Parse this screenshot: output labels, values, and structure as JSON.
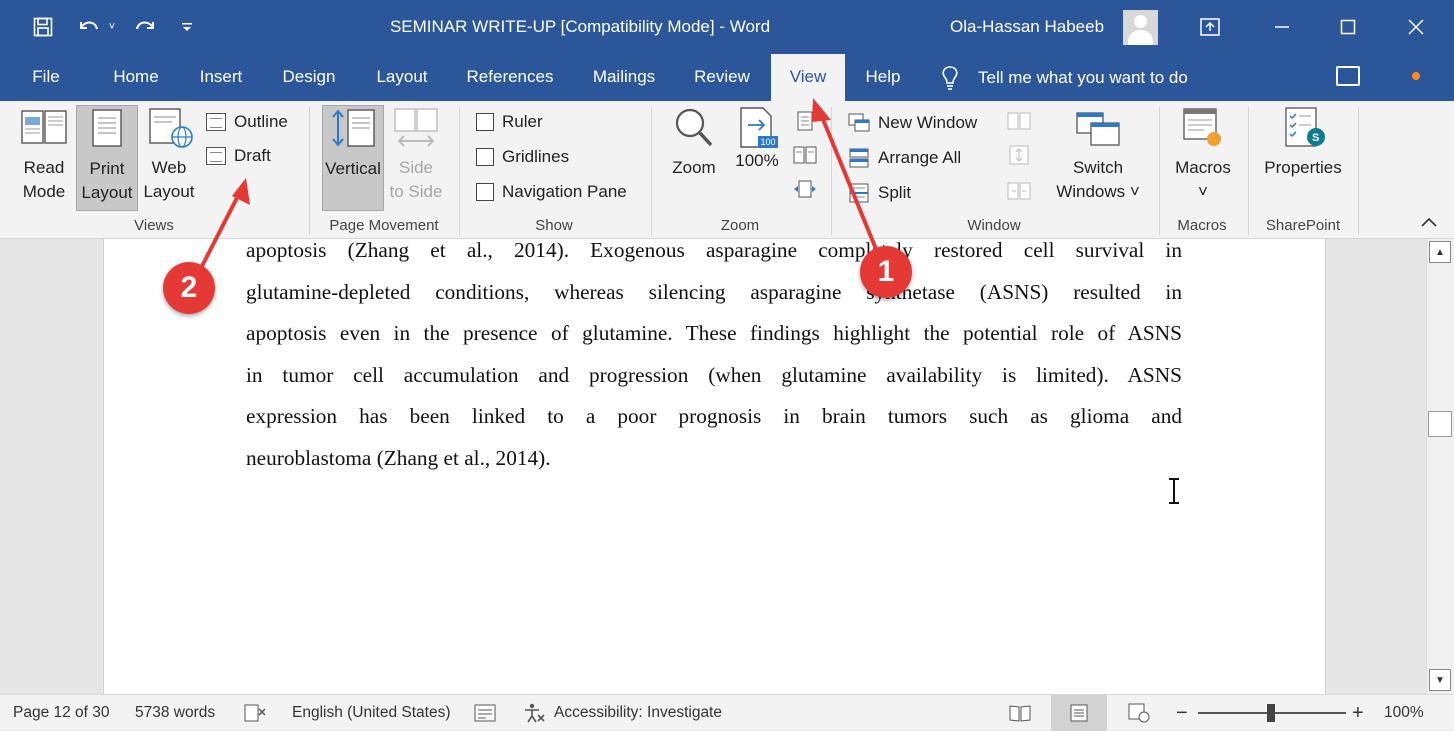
{
  "titlebar": {
    "title": "SEMINAR WRITE-UP [Compatibility Mode]  -  Word",
    "user_name": "Ola-Hassan Habeeb",
    "quick_access": [
      "save-icon",
      "undo-icon",
      "redo-icon",
      "customize-icon"
    ],
    "window_controls": [
      "ribbon-display-icon",
      "minimize-icon",
      "maximize-icon",
      "close-icon"
    ]
  },
  "tabs": [
    {
      "label": "File"
    },
    {
      "label": "Home"
    },
    {
      "label": "Insert"
    },
    {
      "label": "Design"
    },
    {
      "label": "Layout"
    },
    {
      "label": "References"
    },
    {
      "label": "Mailings"
    },
    {
      "label": "Review"
    },
    {
      "label": "View",
      "active": true
    },
    {
      "label": "Help"
    }
  ],
  "tell_me": "Tell me what you want to do",
  "ribbon": {
    "views": {
      "label": "Views",
      "read_mode": "Read\nMode",
      "print_layout": "Print\nLayout",
      "web_layout": "Web\nLayout",
      "outline": "Outline",
      "draft": "Draft"
    },
    "page_movement": {
      "label": "Page Movement",
      "vertical": "Vertical",
      "side_to_side": "Side\nto Side"
    },
    "show": {
      "label": "Show",
      "ruler": "Ruler",
      "gridlines": "Gridlines",
      "navigation_pane": "Navigation Pane"
    },
    "zoom": {
      "label": "Zoom",
      "zoom": "Zoom",
      "hundred": "100%",
      "badge": "100"
    },
    "window": {
      "label": "Window",
      "new_window": "New Window",
      "arrange_all": "Arrange All",
      "split": "Split",
      "switch_windows": "Switch\nWindows ˅"
    },
    "macros": {
      "label": "Macros",
      "macros": "Macros\n˅"
    },
    "sharepoint": {
      "label": "SharePoint",
      "properties": "Properties"
    }
  },
  "document": {
    "lines": [
      "apoptosis (Zhang et al., 2014). Exogenous asparagine completely restored cell survival in",
      "glutamine-depleted conditions, whereas silencing asparagine synthetase (ASNS) resulted in",
      "apoptosis even in the presence of glutamine. These findings highlight the potential role of ASNS",
      "in tumor cell accumulation and progression (when glutamine availability is limited). ASNS",
      "expression has been linked to a poor prognosis in brain tumors such as glioma and",
      "neuroblastoma (Zhang et al., 2014)."
    ]
  },
  "statusbar": {
    "page": "Page 12 of 30",
    "words": "5738 words",
    "language": "English (United States)",
    "accessibility": "Accessibility: Investigate",
    "zoom_percent": "100%",
    "zoom_level": 1.0
  },
  "annotations": {
    "step1": "1",
    "step2": "2",
    "color": "#e53935"
  },
  "colors": {
    "word_blue": "#2b579a",
    "ribbon_bg": "#f3f3f3",
    "page_bg": "#ffffff",
    "canvas_bg": "#e6e6e6"
  }
}
